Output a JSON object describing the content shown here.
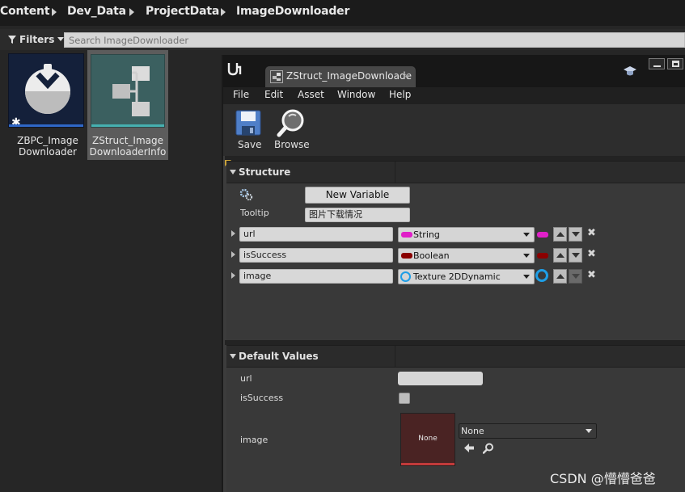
{
  "breadcrumb": {
    "items": [
      "Content",
      "Dev_Data",
      "ProjectData",
      "ImageDownloader"
    ]
  },
  "filters": {
    "label": "Filters",
    "search_placeholder": "Search ImageDownloader"
  },
  "assets": [
    {
      "line1": "ZBPC_Image",
      "line2": "Downloader",
      "icon": "blueprint-sphere-icon",
      "accent": "#2f67c7"
    },
    {
      "line1": "ZStruct_Image",
      "line2": "DownloaderInfo",
      "icon": "struct-icon",
      "accent": "#3f9c9c"
    }
  ],
  "editor": {
    "tab_label": "ZStruct_ImageDownloade",
    "menus": [
      "File",
      "Edit",
      "Asset",
      "Window",
      "Help"
    ],
    "toolbar": {
      "save_label": "Save",
      "browse_label": "Browse"
    },
    "structure": {
      "title": "Structure",
      "new_variable_label": "New Variable",
      "tooltip_label": "Tooltip",
      "tooltip_value": "图片下载情况",
      "variables": [
        {
          "name": "url",
          "type": "String",
          "color": "#e020c8"
        },
        {
          "name": "isSuccess",
          "type": "Boolean",
          "color": "#8a0000"
        },
        {
          "name": "image",
          "type": "Texture 2DDynamic",
          "color": "#1e9ee6"
        }
      ]
    },
    "defaults": {
      "title": "Default Values",
      "url_label": "url",
      "issuccess_label": "isSuccess",
      "image_label": "image",
      "image_preview_text": "None",
      "image_select_value": "None"
    }
  },
  "watermark": "CSDN @懵懵爸爸",
  "colors": {
    "background": "#262626",
    "panel": "#393939",
    "header": "#2b2b2b",
    "selection": "#5e5e5e"
  }
}
